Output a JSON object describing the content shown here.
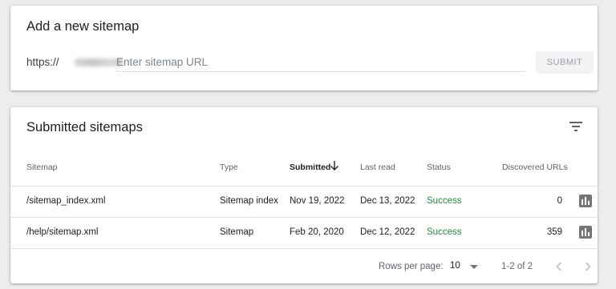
{
  "add_sitemap": {
    "title": "Add a new sitemap",
    "url_prefix": "https://",
    "placeholder": "Enter sitemap URL",
    "submit_label": "SUBMIT"
  },
  "submitted": {
    "title": "Submitted sitemaps",
    "filter_icon": "filter-icon",
    "columns": {
      "sitemap": "Sitemap",
      "type": "Type",
      "submitted": "Submitted",
      "last_read": "Last read",
      "status": "Status",
      "discovered": "Discovered URLs"
    },
    "sort_icon": "arrow-down-icon",
    "rows": [
      {
        "sitemap": "/sitemap_index.xml",
        "type": "Sitemap index",
        "submitted": "Nov 19, 2022",
        "last_read": "Dec 13, 2022",
        "status": "Success",
        "discovered": "0"
      },
      {
        "sitemap": "/help/sitemap.xml",
        "type": "Sitemap",
        "submitted": "Feb 20, 2020",
        "last_read": "Dec 12, 2022",
        "status": "Success",
        "discovered": "359"
      }
    ],
    "row_icon": "bar-chart-icon",
    "footer": {
      "rows_per_page_label": "Rows per page:",
      "rows_per_page_value": "10",
      "range": "1-2 of 2"
    }
  },
  "colors": {
    "status_success": "#1e8e3e",
    "background": "#ededed",
    "icon": "#757575"
  }
}
